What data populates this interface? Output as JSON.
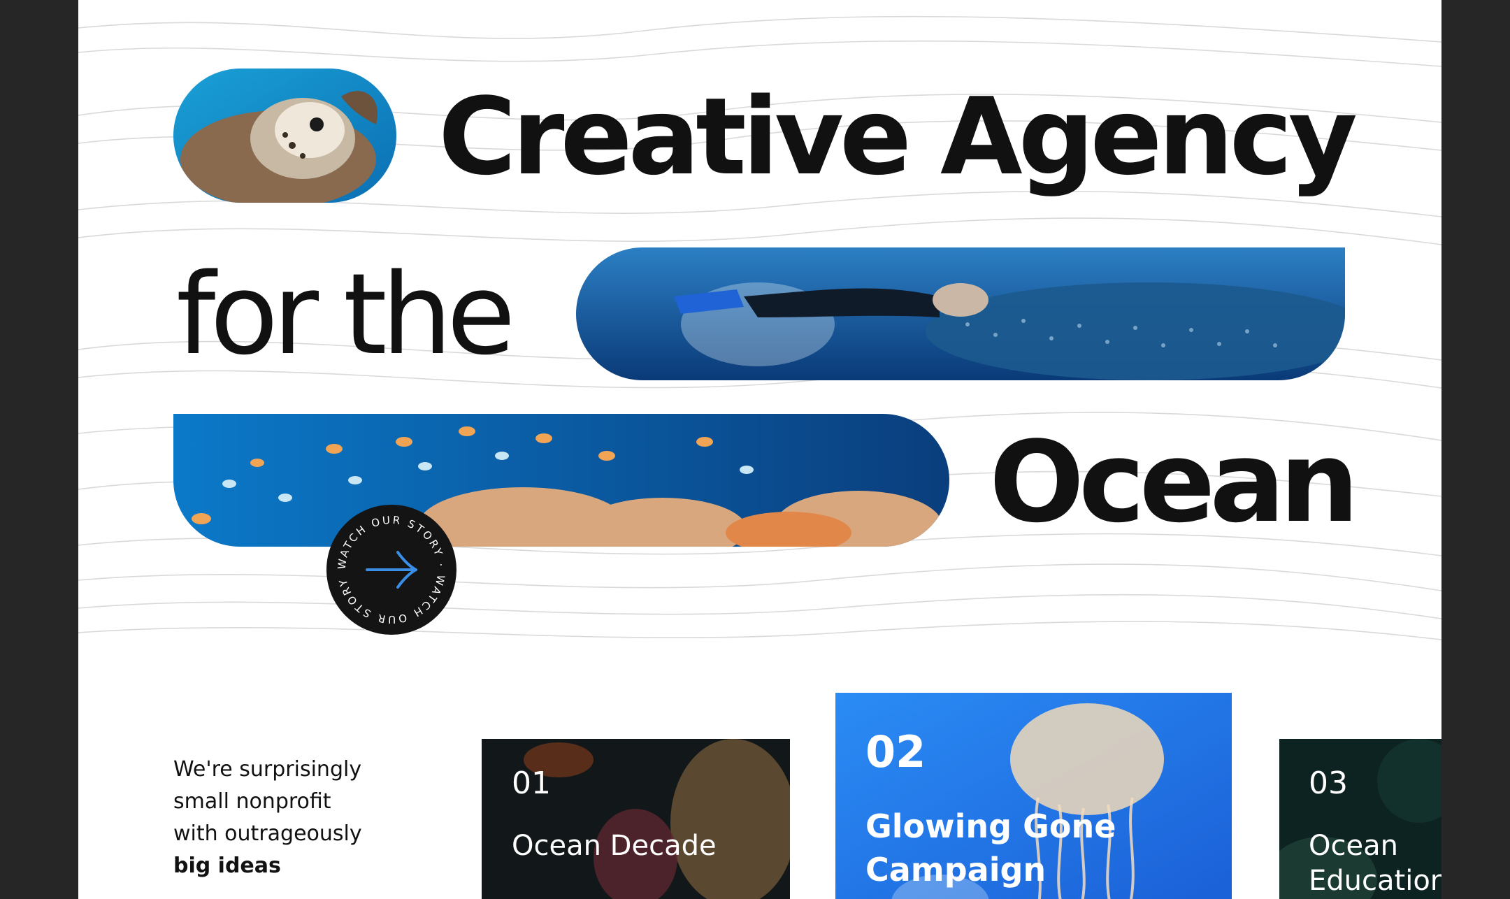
{
  "hero": {
    "line1": "Creative Agency",
    "line2": "for the",
    "line3": "Ocean",
    "watch_button_text": "WATCH OUR STORY · WATCH OUR STORY ·"
  },
  "intro": {
    "lines": [
      "We're surprisingly",
      "small nonprofit",
      "with outrageously"
    ],
    "bold": "big ideas"
  },
  "cards": [
    {
      "number": "01",
      "title": "Ocean Decade"
    },
    {
      "number": "02",
      "title": "Glowing Gone Campaign"
    },
    {
      "number": "03",
      "title": "Ocean Education"
    }
  ],
  "colors": {
    "background": "#ffffff",
    "frame": "#262626",
    "text": "#111111",
    "accent_blue": "#1f7df0",
    "button": "#141414",
    "arrow": "#3a8ee8"
  },
  "icons": {
    "watch_button": "arrow-right-icon"
  }
}
